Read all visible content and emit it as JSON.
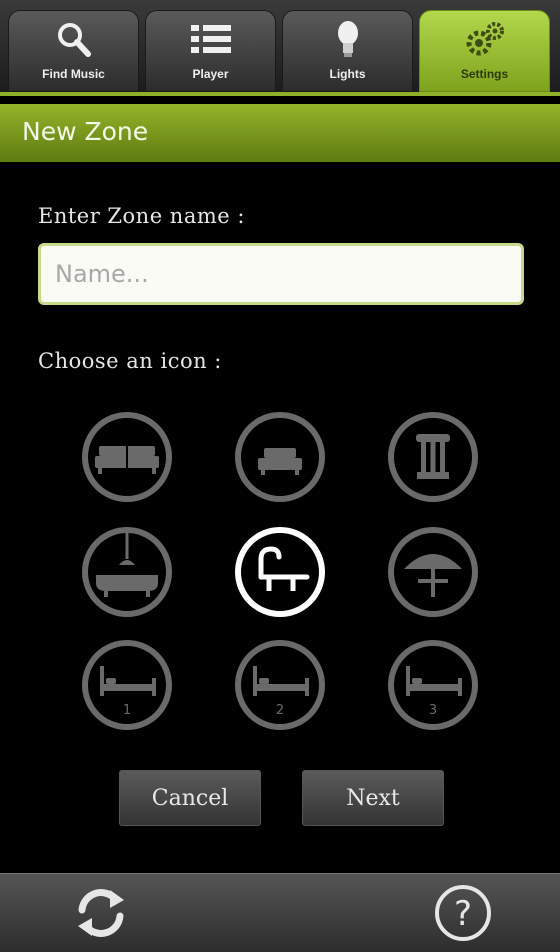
{
  "tabs": [
    {
      "label": "Find Music",
      "icon": "search-icon",
      "active": false
    },
    {
      "label": "Player",
      "icon": "list-icon",
      "active": false
    },
    {
      "label": "Lights",
      "icon": "lightbulb-icon",
      "active": false
    },
    {
      "label": "Settings",
      "icon": "gears-icon",
      "active": true
    }
  ],
  "title": "New Zone",
  "form": {
    "zone_label": "Enter Zone name :",
    "name_placeholder": "Name...",
    "name_value": "",
    "icon_label": "Choose an icon :"
  },
  "icons": [
    {
      "name": "sofa-icon",
      "selected": false
    },
    {
      "name": "armchair-icon",
      "selected": false
    },
    {
      "name": "column-icon",
      "selected": false
    },
    {
      "name": "bathtub-icon",
      "selected": false
    },
    {
      "name": "pool-icon",
      "selected": true
    },
    {
      "name": "parasol-icon",
      "selected": false
    },
    {
      "name": "bedroom-1-icon",
      "number": "1",
      "selected": false
    },
    {
      "name": "bedroom-2-icon",
      "number": "2",
      "selected": false
    },
    {
      "name": "bedroom-3-icon",
      "number": "3",
      "selected": false
    }
  ],
  "buttons": {
    "cancel": "Cancel",
    "next": "Next"
  },
  "bottom": {
    "left_icon": "refresh-icon",
    "right_icon": "help-icon"
  },
  "colors": {
    "accent": "#8fb12a",
    "selected_ring": "#ffffff",
    "ring": "#6a6a6a"
  }
}
